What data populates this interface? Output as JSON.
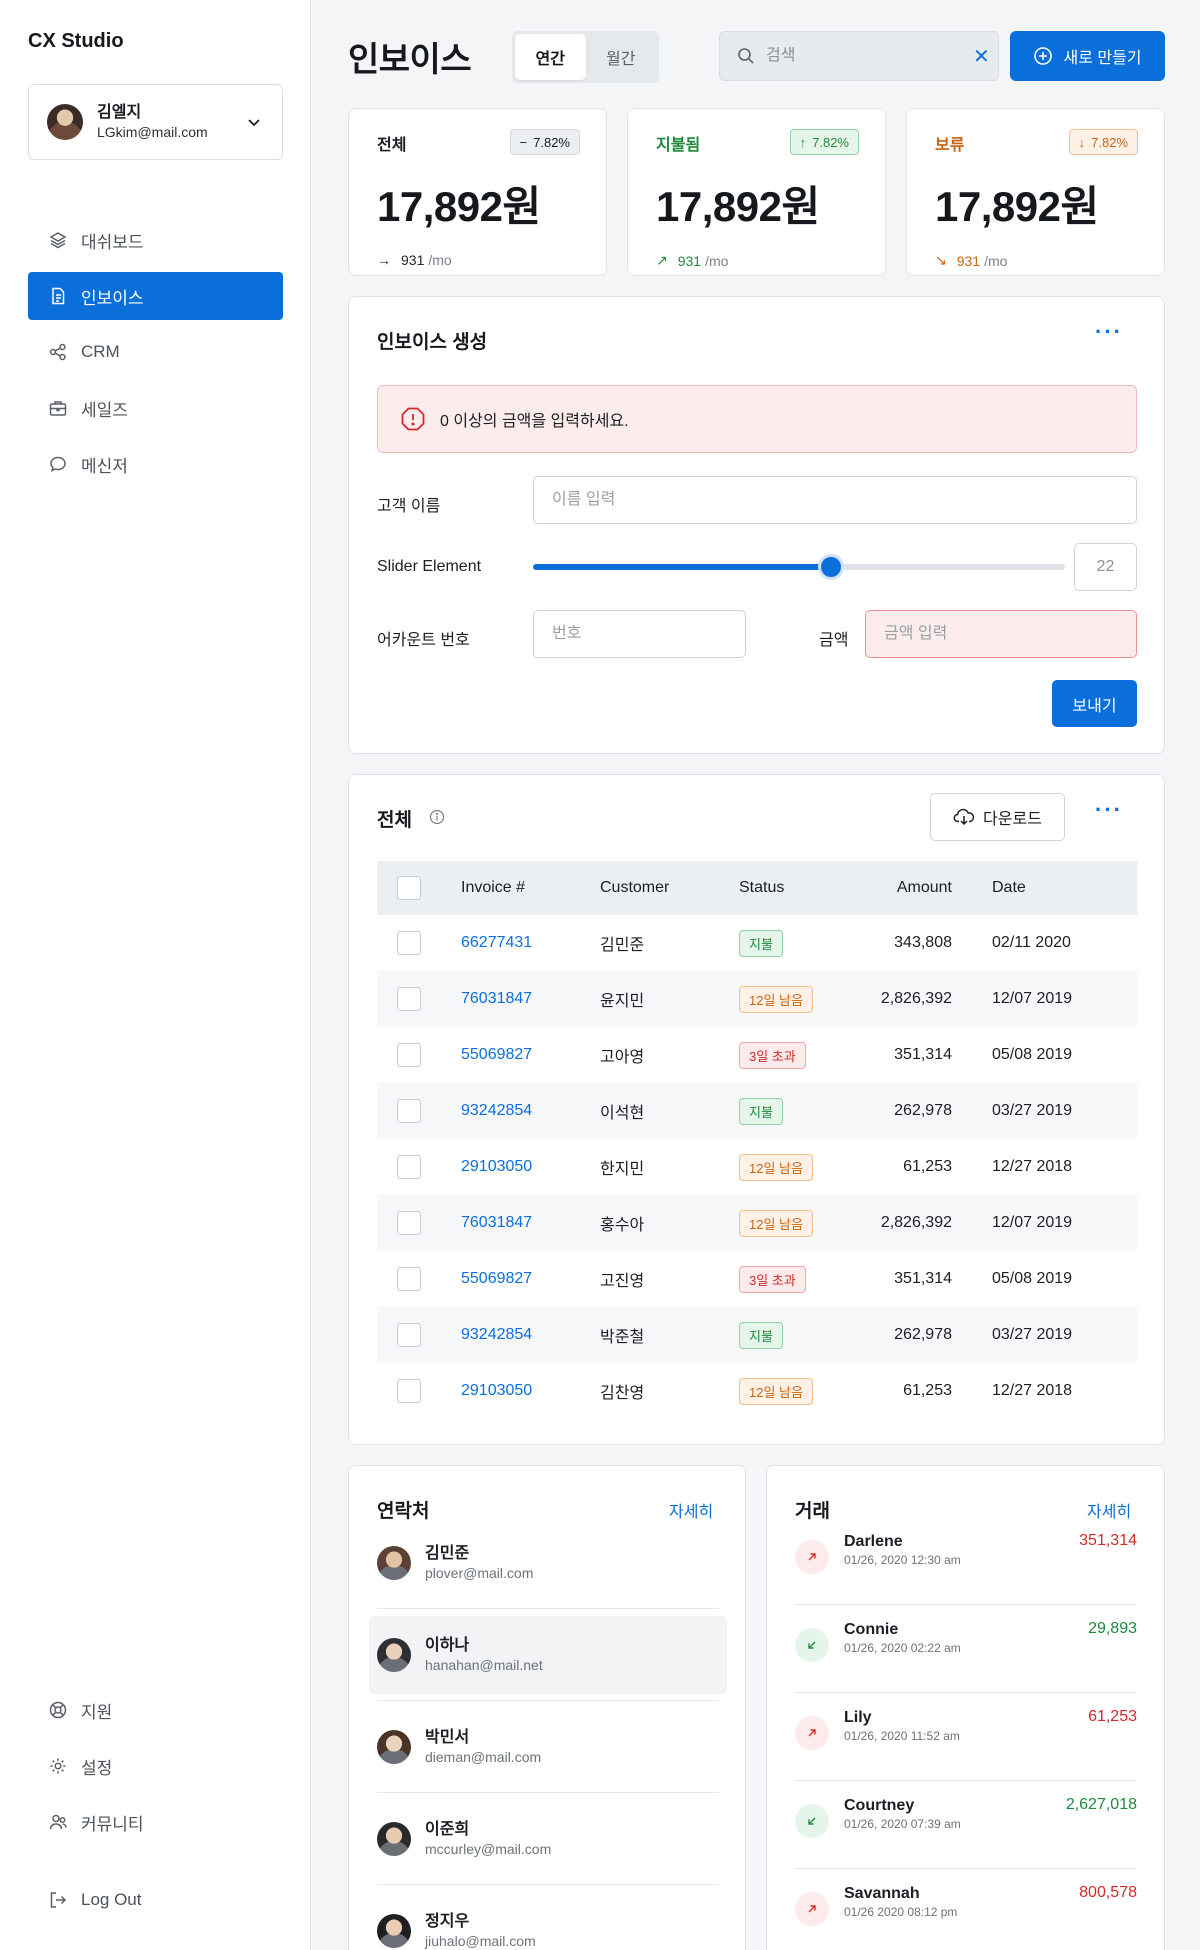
{
  "app": {
    "brand": "CX Studio"
  },
  "user": {
    "name": "김엘지",
    "email": "LGkim@mail.com"
  },
  "nav": [
    {
      "label": "대쉬보드",
      "icon": "layers-icon"
    },
    {
      "label": "인보이스",
      "icon": "invoice-icon",
      "active": true
    },
    {
      "label": "CRM",
      "icon": "share-icon"
    },
    {
      "label": "세일즈",
      "icon": "briefcase-icon"
    },
    {
      "label": "메신저",
      "icon": "chat-icon"
    }
  ],
  "nav_bottom": [
    {
      "label": "지원",
      "icon": "support-icon"
    },
    {
      "label": "설정",
      "icon": "gear-icon"
    },
    {
      "label": "커뮤니티",
      "icon": "community-icon"
    }
  ],
  "logout": "Log Out",
  "header": {
    "title": "인보이스",
    "tabs": [
      "연간",
      "월간"
    ],
    "search_placeholder": "검색",
    "new_button": "새로 만들기"
  },
  "stats": [
    {
      "label": "전체",
      "badge": "7.82%",
      "badge_icon": "−",
      "value": "17,892원",
      "foot_value": "931",
      "foot_unit": "/mo",
      "tone": "neutral",
      "color": "#1b1f24"
    },
    {
      "label": "지불됨",
      "badge": "7.82%",
      "badge_icon": "↑",
      "value": "17,892원",
      "foot_value": "931",
      "foot_unit": "/mo",
      "tone": "up",
      "color": "#1f8a3d"
    },
    {
      "label": "보류",
      "badge": "7.82%",
      "badge_icon": "↓",
      "value": "17,892원",
      "foot_value": "931",
      "foot_unit": "/mo",
      "tone": "down",
      "color": "#c9650f"
    }
  ],
  "form": {
    "title": "인보이스 생성",
    "alert": "0 이상의 금액을 입력하세요.",
    "customer_label": "고객 이름",
    "customer_placeholder": "이름 입력",
    "slider_label": "Slider Element",
    "slider_value": "22",
    "slider_fraction": 0.56,
    "account_label": "어카운트 번호",
    "account_placeholder": "번호",
    "amount_label": "금액",
    "amount_placeholder": "금액 입력",
    "send": "보내기"
  },
  "table": {
    "title": "전체",
    "download": "다운로드",
    "columns": [
      "Invoice #",
      "Customer",
      "Status",
      "Amount",
      "Date"
    ],
    "rows": [
      {
        "invoice": "66277431",
        "customer": "김민준",
        "status": "지불",
        "status_type": "paid",
        "amount": "343,808",
        "date": "02/11 2020"
      },
      {
        "invoice": "76031847",
        "customer": "윤지민",
        "status": "12일 남음",
        "status_type": "pending",
        "amount": "2,826,392",
        "date": "12/07 2019"
      },
      {
        "invoice": "55069827",
        "customer": "고아영",
        "status": "3일 초과",
        "status_type": "overdue",
        "amount": "351,314",
        "date": "05/08 2019"
      },
      {
        "invoice": "93242854",
        "customer": "이석현",
        "status": "지불",
        "status_type": "paid",
        "amount": "262,978",
        "date": "03/27 2019"
      },
      {
        "invoice": "29103050",
        "customer": "한지민",
        "status": "12일 남음",
        "status_type": "pending",
        "amount": "61,253",
        "date": "12/27 2018"
      },
      {
        "invoice": "76031847",
        "customer": "홍수아",
        "status": "12일 남음",
        "status_type": "pending",
        "amount": "2,826,392",
        "date": "12/07 2019"
      },
      {
        "invoice": "55069827",
        "customer": "고진영",
        "status": "3일 초과",
        "status_type": "overdue",
        "amount": "351,314",
        "date": "05/08 2019"
      },
      {
        "invoice": "93242854",
        "customer": "박준철",
        "status": "지불",
        "status_type": "paid",
        "amount": "262,978",
        "date": "03/27 2019"
      },
      {
        "invoice": "29103050",
        "customer": "김찬영",
        "status": "12일 남음",
        "status_type": "pending",
        "amount": "61,253",
        "date": "12/27 2018"
      }
    ]
  },
  "contacts": {
    "title": "연락처",
    "more": "자세히",
    "items": [
      {
        "name": "김민준",
        "email": "plover@mail.com"
      },
      {
        "name": "이하나",
        "email": "hanahan@mail.net"
      },
      {
        "name": "박민서",
        "email": "dieman@mail.com"
      },
      {
        "name": "이준희",
        "email": "mccurley@mail.com"
      },
      {
        "name": "정지우",
        "email": "jiuhalo@mail.com"
      }
    ]
  },
  "deals": {
    "title": "거래",
    "more": "자세히",
    "items": [
      {
        "name": "Darlene",
        "date": "01/26, 2020 12:30 am",
        "amount": "351,314",
        "direction": "up"
      },
      {
        "name": "Connie",
        "date": "01/26, 2020 02:22 am",
        "amount": "29,893",
        "direction": "down"
      },
      {
        "name": "Lily",
        "date": "01/26, 2020 11:52 am",
        "amount": "61,253",
        "direction": "up"
      },
      {
        "name": "Courtney",
        "date": "01/26, 2020 07:39 am",
        "amount": "2,627,018",
        "direction": "down"
      },
      {
        "name": "Savannah",
        "date": "01/26 2020 08:12 pm",
        "amount": "800,578",
        "direction": "up"
      }
    ]
  },
  "colors": {
    "accent": "#0b6fdb",
    "paid": "#1f8a3d",
    "pending": "#c9650f",
    "overdue": "#d42a2a"
  }
}
